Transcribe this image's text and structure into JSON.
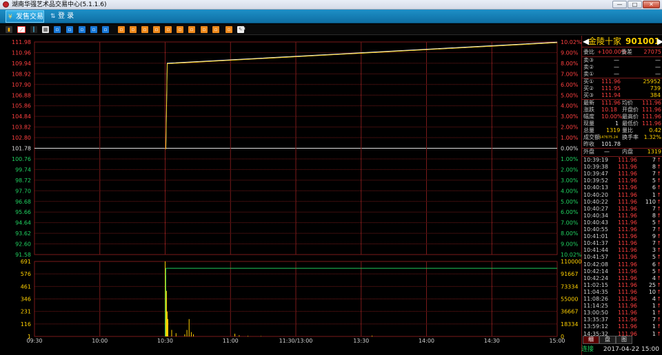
{
  "window": {
    "title": "湖南华强艺术品交易中心(5.1.1.6)",
    "minimize": "—",
    "maximize": "□",
    "close": "✕"
  },
  "menu": {
    "items": [
      {
        "label": "发售交易",
        "icon": "yen-icon"
      },
      {
        "label": "登  录",
        "icon": "login-icon"
      }
    ]
  },
  "toolbar": {
    "icons": [
      "bar-chart-icon",
      "line-chart-icon",
      "candlestick-icon",
      "calendar-icon",
      "f1-icon",
      "f2-icon",
      "f3-icon",
      "f4-icon",
      "f5-icon",
      "f6-icon",
      "f7-icon",
      "f8-icon",
      "f9-icon",
      "f10-icon",
      "f11-icon",
      "f12-icon",
      "f13-icon",
      "f14-icon",
      "f15-icon",
      "pencil-icon",
      "gear-icon"
    ]
  },
  "colors": {
    "up": "#ff4040",
    "down": "#20d060",
    "grid": "#7a1a1a",
    "accent": "#ffd000"
  },
  "chart_data": [
    {
      "type": "line",
      "panel": "price",
      "y_left_ticks": [
        "111.98",
        "110.96",
        "109.94",
        "108.92",
        "107.90",
        "106.88",
        "105.86",
        "104.84",
        "103.82",
        "102.80",
        "101.78",
        "100.76",
        "99.74",
        "98.72",
        "97.70",
        "96.68",
        "95.66",
        "94.64",
        "93.62",
        "92.60",
        "91.58"
      ],
      "y_right_ticks": [
        "10.02%",
        "9.00%",
        "8.00%",
        "7.00%",
        "6.00%",
        "5.00%",
        "4.00%",
        "3.00%",
        "2.00%",
        "1.00%",
        "0.00%",
        "1.00%",
        "2.00%",
        "3.00%",
        "4.00%",
        "5.00%",
        "6.00%",
        "7.00%",
        "8.00%",
        "9.00%",
        "10.02%"
      ],
      "ylim": [
        91.58,
        111.98
      ],
      "prev_close": 101.78,
      "series": [
        {
          "x": [
            "10:30",
            "10:30",
            "10:30",
            "10:30",
            "15:00"
          ],
          "values": [
            101.78,
            101.78,
            105.86,
            109.94,
            111.96
          ]
        }
      ]
    },
    {
      "type": "bar",
      "panel": "volume",
      "y_left_ticks": [
        "691",
        "576",
        "461",
        "346",
        "231",
        "116",
        "1"
      ],
      "y_right_ticks": [
        "110000",
        "91667",
        "73334",
        "55000",
        "36667",
        "18334",
        "0"
      ],
      "ylim": [
        0,
        691
      ],
      "cumulative_line_value": 1319,
      "bars": [
        {
          "x": "10:30",
          "value": 691
        },
        {
          "x": "10:30",
          "value": 560
        },
        {
          "x": "10:30",
          "value": 420
        },
        {
          "x": "10:30",
          "value": 230
        },
        {
          "x": "10:30",
          "value": 160
        },
        {
          "x": "10:31",
          "value": 90
        },
        {
          "x": "10:33",
          "value": 60
        },
        {
          "x": "10:35",
          "value": 30
        },
        {
          "x": "10:39",
          "value": 20
        },
        {
          "x": "10:40",
          "value": 60
        },
        {
          "x": "10:41",
          "value": 160
        },
        {
          "x": "10:42",
          "value": 40
        },
        {
          "x": "10:43",
          "value": 20
        },
        {
          "x": "11:02",
          "value": 25
        },
        {
          "x": "11:04",
          "value": 10
        },
        {
          "x": "11:08",
          "value": 5
        },
        {
          "x": "11:14",
          "value": 3
        },
        {
          "x": "13:35",
          "value": 7
        }
      ]
    }
  ],
  "x_ticks": [
    "09:30",
    "10:00",
    "10:30",
    "11:00",
    "11:30/13:00",
    "13:30",
    "14:00",
    "14:30",
    "15:00"
  ],
  "panel": {
    "stock_name": "金陵十家",
    "stock_code": "901001",
    "left_arrow": "◀",
    "right_arrow": "▶",
    "weibi_label": "委比",
    "weibi_value": "+100.00%",
    "weicha_label": "委差",
    "weicha_value": "27075",
    "sells": [
      {
        "label": "卖③",
        "price": "—",
        "vol": "—"
      },
      {
        "label": "卖②",
        "price": "—",
        "vol": "—"
      },
      {
        "label": "卖①",
        "price": "—",
        "vol": "—"
      }
    ],
    "buys": [
      {
        "label": "买①",
        "price": "111.96",
        "vol": "25952"
      },
      {
        "label": "买②",
        "price": "111.95",
        "vol": "739"
      },
      {
        "label": "买③",
        "price": "111.94",
        "vol": "384"
      }
    ],
    "stats": [
      {
        "l1": "最新",
        "v1": "111.96",
        "l2": "均价",
        "v2": "111.96"
      },
      {
        "l1": "涨跌",
        "v1": "10.18",
        "l2": "开盘价",
        "v2": "111.96"
      },
      {
        "l1": "幅度",
        "v1": "10.00%",
        "l2": "最高价",
        "v2": "111.96"
      },
      {
        "l1": "现量",
        "v1": "1",
        "l2": "最低价",
        "v2": "111.96"
      },
      {
        "l1": "总量",
        "v1": "1319",
        "l2": "量比",
        "v2": "0.42"
      },
      {
        "l1": "成交额",
        "v1": "147675.24",
        "l2": "换手率",
        "v2": "1.32%"
      }
    ],
    "prev_label": "昨收",
    "prev_value": "101.78",
    "outer_label": "外盘",
    "outer_value": "—",
    "inner_label": "内盘",
    "inner_value": "1319",
    "ticks": [
      {
        "time": "10:39:19",
        "price": "111.96",
        "vol": "7",
        "arrow": "↑"
      },
      {
        "time": "10:39:38",
        "price": "111.96",
        "vol": "8",
        "arrow": "↑"
      },
      {
        "time": "10:39:47",
        "price": "111.96",
        "vol": "7",
        "arrow": "↑"
      },
      {
        "time": "10:39:52",
        "price": "111.96",
        "vol": "5",
        "arrow": "↑"
      },
      {
        "time": "10:40:13",
        "price": "111.96",
        "vol": "6",
        "arrow": "↑"
      },
      {
        "time": "10:40:20",
        "price": "111.96",
        "vol": "1",
        "arrow": "↑"
      },
      {
        "time": "10:40:22",
        "price": "111.96",
        "vol": "110",
        "arrow": "↑"
      },
      {
        "time": "10:40:27",
        "price": "111.96",
        "vol": "7",
        "arrow": "↑"
      },
      {
        "time": "10:40:34",
        "price": "111.96",
        "vol": "8",
        "arrow": "↑"
      },
      {
        "time": "10:40:43",
        "price": "111.96",
        "vol": "5",
        "arrow": "↑"
      },
      {
        "time": "10:40:55",
        "price": "111.96",
        "vol": "7",
        "arrow": "↑"
      },
      {
        "time": "10:41:01",
        "price": "111.96",
        "vol": "9",
        "arrow": "↑"
      },
      {
        "time": "10:41:37",
        "price": "111.96",
        "vol": "7",
        "arrow": "↑"
      },
      {
        "time": "10:41:44",
        "price": "111.96",
        "vol": "3",
        "arrow": "↑"
      },
      {
        "time": "10:41:57",
        "price": "111.96",
        "vol": "5",
        "arrow": "↑"
      },
      {
        "time": "10:42:08",
        "price": "111.96",
        "vol": "6",
        "arrow": "↑"
      },
      {
        "time": "10:42:14",
        "price": "111.96",
        "vol": "5",
        "arrow": "↑"
      },
      {
        "time": "10:42:24",
        "price": "111.96",
        "vol": "4",
        "arrow": "↑"
      },
      {
        "time": "11:02:15",
        "price": "111.96",
        "vol": "25",
        "arrow": "↑"
      },
      {
        "time": "11:04:35",
        "price": "111.96",
        "vol": "10",
        "arrow": "↑"
      },
      {
        "time": "11:08:26",
        "price": "111.96",
        "vol": "4",
        "arrow": "↑"
      },
      {
        "time": "11:14:25",
        "price": "111.96",
        "vol": "1",
        "arrow": "↑"
      },
      {
        "time": "13:00:50",
        "price": "111.96",
        "vol": "1",
        "arrow": "↑"
      },
      {
        "time": "13:35:37",
        "price": "111.96",
        "vol": "7",
        "arrow": "↑"
      },
      {
        "time": "13:59:12",
        "price": "111.96",
        "vol": "1",
        "arrow": "↑"
      },
      {
        "time": "14:35:32",
        "price": "111.96",
        "vol": "1",
        "arrow": "↑"
      }
    ],
    "tabs": [
      "细",
      "盘",
      "图"
    ],
    "status_conn": "连接",
    "status_time": "2017-04-22 15:00"
  }
}
